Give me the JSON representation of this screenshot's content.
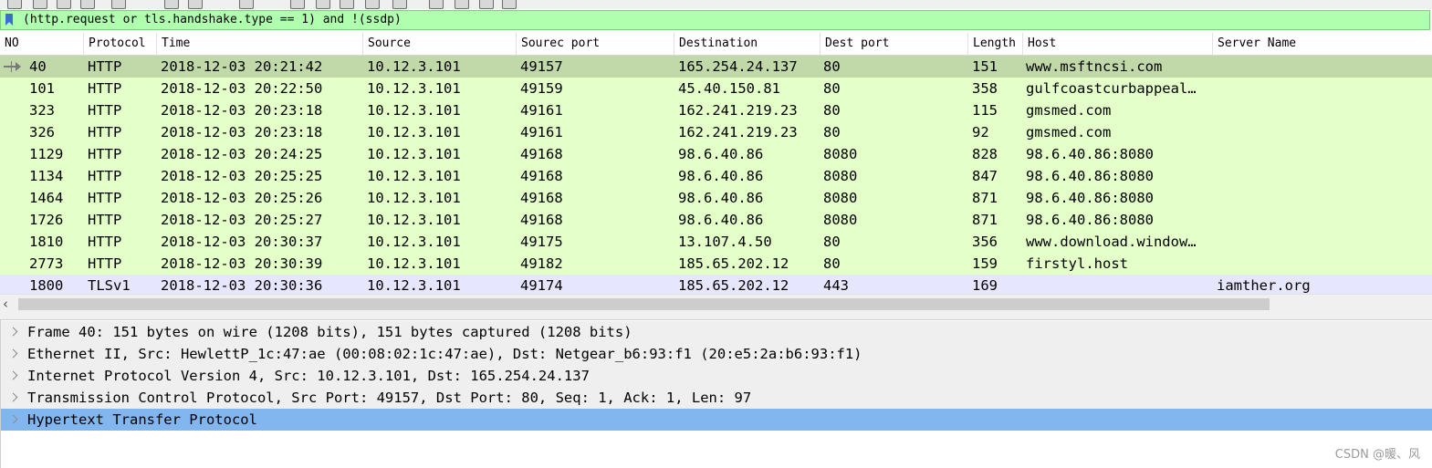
{
  "filter": {
    "text": "(http.request or tls.handshake.type == 1) and !(ssdp)"
  },
  "columns": [
    {
      "label": "NO"
    },
    {
      "label": "Protocol"
    },
    {
      "label": "Time"
    },
    {
      "label": "Source"
    },
    {
      "label": "Sourec port"
    },
    {
      "label": "Destination"
    },
    {
      "label": "Dest port"
    },
    {
      "label": "Length"
    },
    {
      "label": "Host"
    },
    {
      "label": "Server Name"
    }
  ],
  "packets": [
    {
      "no": "40",
      "protocol": "HTTP",
      "time": "2018-12-03 20:21:42",
      "source": "10.12.3.101",
      "src_port": "49157",
      "destination": "165.254.24.137",
      "dest_port": "80",
      "length": "151",
      "host": "www.msftncsi.com",
      "server_name": "",
      "type": "http",
      "selected": true
    },
    {
      "no": "101",
      "protocol": "HTTP",
      "time": "2018-12-03 20:22:50",
      "source": "10.12.3.101",
      "src_port": "49159",
      "destination": "45.40.150.81",
      "dest_port": "80",
      "length": "358",
      "host": "gulfcoastcurbappeal…",
      "server_name": "",
      "type": "http",
      "selected": false
    },
    {
      "no": "323",
      "protocol": "HTTP",
      "time": "2018-12-03 20:23:18",
      "source": "10.12.3.101",
      "src_port": "49161",
      "destination": "162.241.219.23",
      "dest_port": "80",
      "length": "115",
      "host": "gmsmed.com",
      "server_name": "",
      "type": "http",
      "selected": false
    },
    {
      "no": "326",
      "protocol": "HTTP",
      "time": "2018-12-03 20:23:18",
      "source": "10.12.3.101",
      "src_port": "49161",
      "destination": "162.241.219.23",
      "dest_port": "80",
      "length": "92",
      "host": "gmsmed.com",
      "server_name": "",
      "type": "http",
      "selected": false
    },
    {
      "no": "1129",
      "protocol": "HTTP",
      "time": "2018-12-03 20:24:25",
      "source": "10.12.3.101",
      "src_port": "49168",
      "destination": "98.6.40.86",
      "dest_port": "8080",
      "length": "828",
      "host": "98.6.40.86:8080",
      "server_name": "",
      "type": "http",
      "selected": false
    },
    {
      "no": "1134",
      "protocol": "HTTP",
      "time": "2018-12-03 20:25:25",
      "source": "10.12.3.101",
      "src_port": "49168",
      "destination": "98.6.40.86",
      "dest_port": "8080",
      "length": "847",
      "host": "98.6.40.86:8080",
      "server_name": "",
      "type": "http",
      "selected": false
    },
    {
      "no": "1464",
      "protocol": "HTTP",
      "time": "2018-12-03 20:25:26",
      "source": "10.12.3.101",
      "src_port": "49168",
      "destination": "98.6.40.86",
      "dest_port": "8080",
      "length": "871",
      "host": "98.6.40.86:8080",
      "server_name": "",
      "type": "http",
      "selected": false
    },
    {
      "no": "1726",
      "protocol": "HTTP",
      "time": "2018-12-03 20:25:27",
      "source": "10.12.3.101",
      "src_port": "49168",
      "destination": "98.6.40.86",
      "dest_port": "8080",
      "length": "871",
      "host": "98.6.40.86:8080",
      "server_name": "",
      "type": "http",
      "selected": false
    },
    {
      "no": "1810",
      "protocol": "HTTP",
      "time": "2018-12-03 20:30:37",
      "source": "10.12.3.101",
      "src_port": "49175",
      "destination": "13.107.4.50",
      "dest_port": "80",
      "length": "356",
      "host": "www.download.window…",
      "server_name": "",
      "type": "http",
      "selected": false
    },
    {
      "no": "2773",
      "protocol": "HTTP",
      "time": "2018-12-03 20:30:39",
      "source": "10.12.3.101",
      "src_port": "49182",
      "destination": "185.65.202.12",
      "dest_port": "80",
      "length": "159",
      "host": "firstyl.host",
      "server_name": "",
      "type": "http",
      "selected": false
    },
    {
      "no": "1800",
      "protocol": "TLSv1",
      "time": "2018-12-03 20:30:36",
      "source": "10.12.3.101",
      "src_port": "49174",
      "destination": "185.65.202.12",
      "dest_port": "443",
      "length": "169",
      "host": "",
      "server_name": "iamther.org",
      "type": "tls",
      "selected": false
    }
  ],
  "details": [
    {
      "text": "Frame 40: 151 bytes on wire (1208 bits), 151 bytes captured (1208 bits)",
      "selected": false
    },
    {
      "text": "Ethernet II, Src: HewlettP_1c:47:ae (00:08:02:1c:47:ae), Dst: Netgear_b6:93:f1 (20:e5:2a:b6:93:f1)",
      "selected": false
    },
    {
      "text": "Internet Protocol Version 4, Src: 10.12.3.101, Dst: 165.254.24.137",
      "selected": false
    },
    {
      "text": "Transmission Control Protocol, Src Port: 49157, Dst Port: 80, Seq: 1, Ack: 1, Len: 97",
      "selected": false
    },
    {
      "text": "Hypertext Transfer Protocol",
      "selected": true
    }
  ],
  "watermark": "CSDN @暖、风",
  "colors": {
    "filter_valid_bg": "#afffaf",
    "http_row_bg": "#e4ffc7",
    "tls_row_bg": "#e7e6ff",
    "selected_packet_bg": "#c1d9a8",
    "selected_detail_bg": "#82b6ef"
  }
}
